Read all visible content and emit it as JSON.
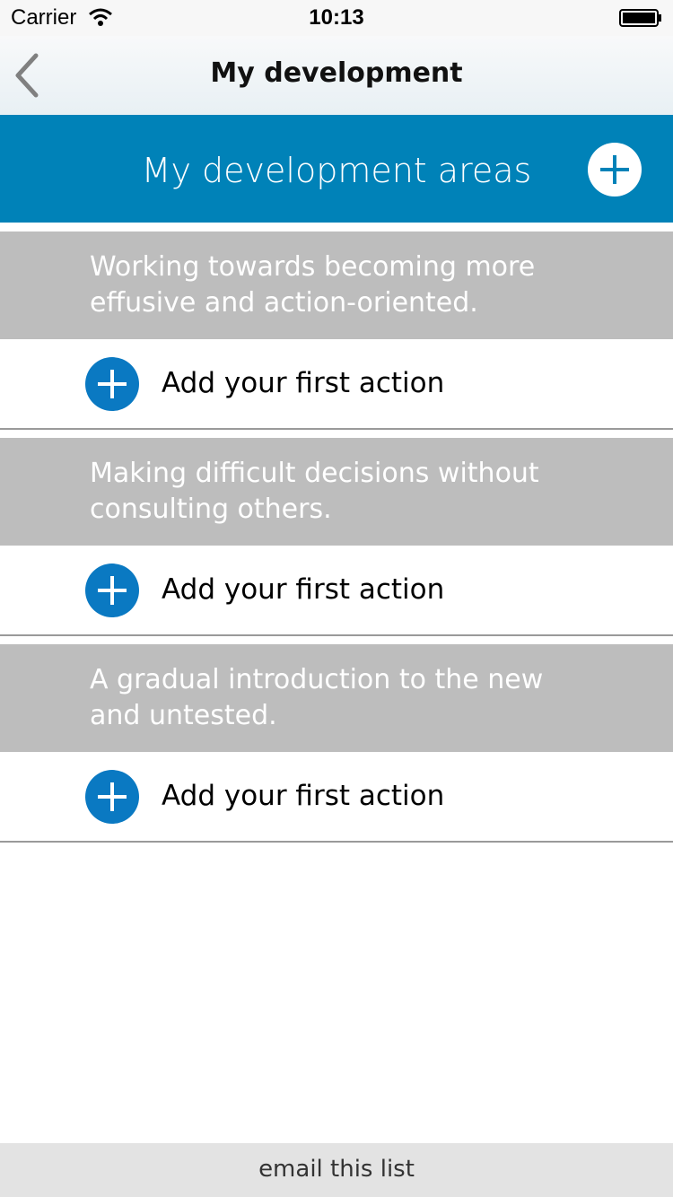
{
  "status_bar": {
    "carrier": "Carrier",
    "time": "10:13"
  },
  "nav": {
    "title": "My development",
    "back_icon": "chevron-left-icon"
  },
  "header": {
    "title": "My development areas",
    "add_icon": "plus-circle-icon",
    "background": "#0082b8"
  },
  "areas": [
    {
      "text": "Working towards becoming more effusive and action-oriented.",
      "action_label": "Add your first action"
    },
    {
      "text": "Making difficult decisions without consulting others.",
      "action_label": "Add your first action"
    },
    {
      "text": "A gradual introduction to the new and untested.",
      "action_label": "Add your first action"
    }
  ],
  "footer": {
    "label": "email this list"
  },
  "colors": {
    "accent": "#0a79c2",
    "area_bg": "#bdbdbd"
  }
}
